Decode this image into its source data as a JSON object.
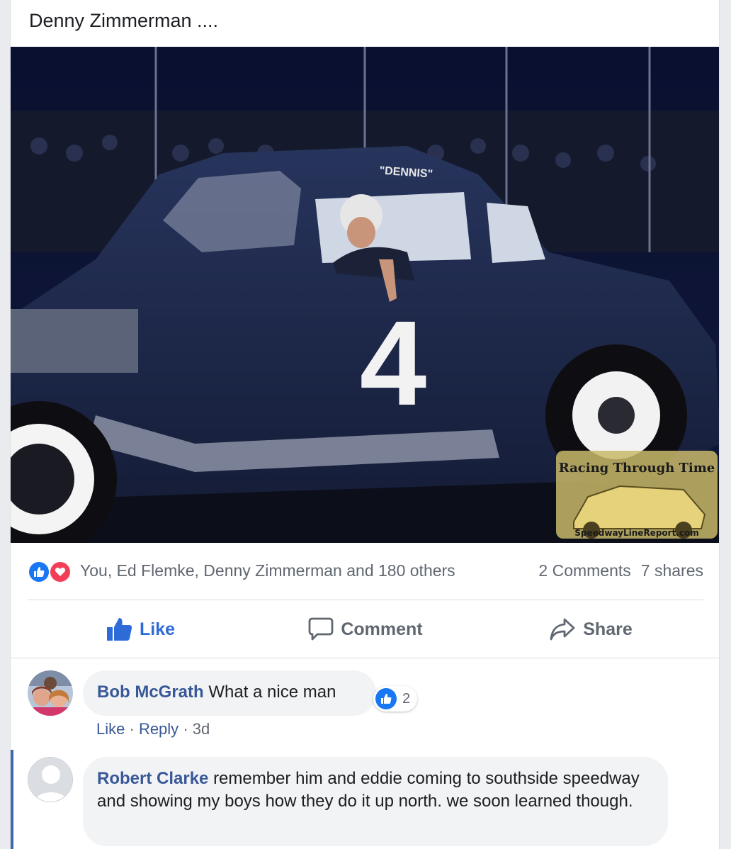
{
  "post": {
    "text": "Denny Zimmerman ...."
  },
  "photo": {
    "alt": "Vintage race car number 4",
    "car_number": "4",
    "roof_name": "\"DENNIS\"",
    "watermark_top": "Racing Through Time",
    "watermark_bottom": "SpeedwayLineReport.com"
  },
  "stats": {
    "reactors": "You, Ed Flemke, Denny Zimmerman and 180 others",
    "comments": "2 Comments",
    "shares": "7 shares"
  },
  "actions": {
    "like": "Like",
    "comment": "Comment",
    "share": "Share"
  },
  "comments": [
    {
      "author": "Bob McGrath",
      "text": "What a nice man",
      "reaction_count": "2",
      "like": "Like",
      "reply": "Reply",
      "time": "3d"
    },
    {
      "author": "Robert Clarke",
      "text": "remember him and eddie coming to southside speedway and showing my boys how they do it up north. we soon learned though."
    }
  ],
  "colors": {
    "link": "#385898",
    "like_blue": "#1877f2",
    "love_red": "#f33e58",
    "muted": "#606770"
  }
}
